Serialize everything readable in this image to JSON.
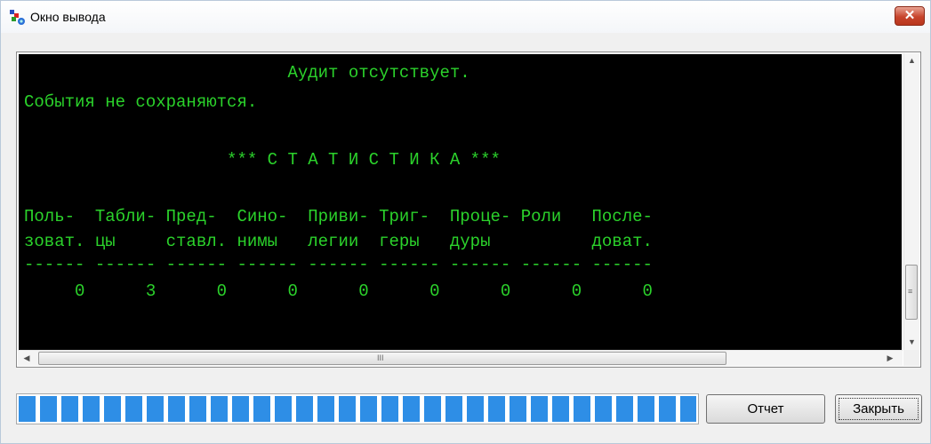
{
  "window": {
    "title": "Окно вывода"
  },
  "output": {
    "lines": [
      "                          Аудит отсутствует.",
      "События не сохраняются.",
      "",
      "                    *** С Т А Т И С Т И К А ***",
      "",
      "Поль-  Табли- Пред-  Сино-  Приви- Триг-  Проце- Роли   После-",
      "зоват. цы     ставл. нимы   легии  геры   дуры          доват.",
      "------ ------ ------ ------ ------ ------ ------ ------ ------",
      "     0      3      0      0      0      0      0      0      0"
    ]
  },
  "scrollbar": {
    "h_grip": "III",
    "v_grip": "≡"
  },
  "progress": {
    "value_fraction": 1.0
  },
  "buttons": {
    "report": "Отчет",
    "close": "Закрыть"
  },
  "icons": {
    "app": "output-window-icon",
    "close": "close-icon"
  },
  "colors": {
    "terminal_bg": "#000000",
    "terminal_text": "#2bd22b",
    "progress_fill": "#2e8ee6",
    "close_button": "#c7442c"
  }
}
